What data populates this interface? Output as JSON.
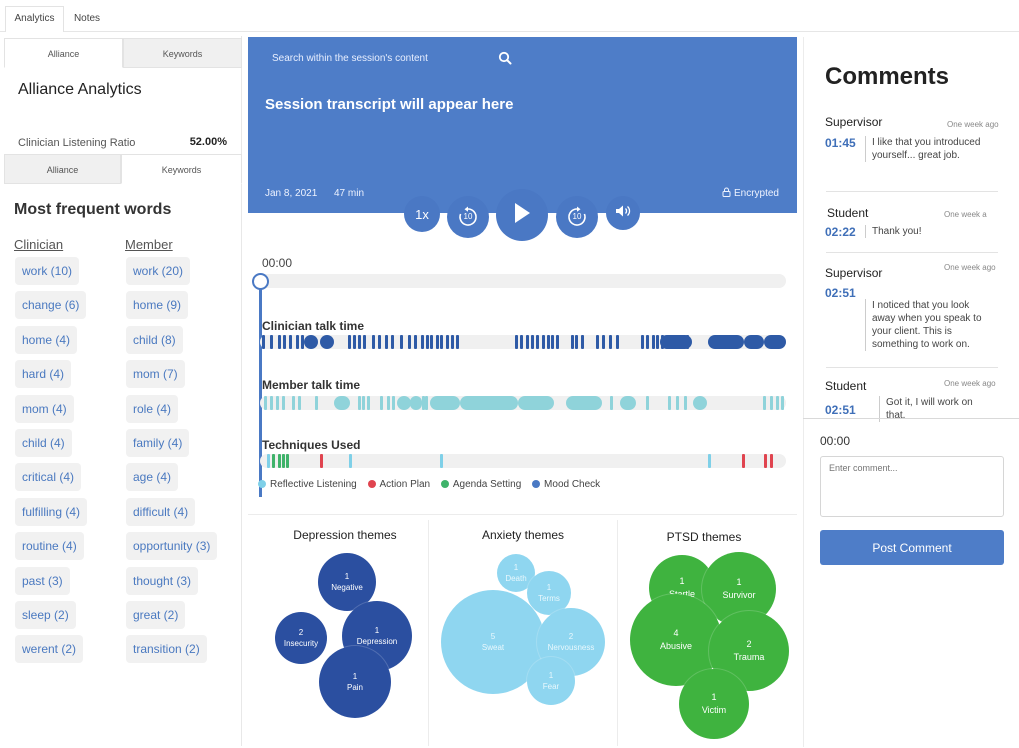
{
  "top_tabs": [
    "Analytics",
    "Notes"
  ],
  "left": {
    "subtabs_top": [
      "Alliance",
      "Keywords"
    ],
    "alliance_title": "Alliance Analytics",
    "ratio_label": "Clinician Listening Ratio",
    "ratio_value": "52.00%",
    "subtabs_bottom": [
      "Alliance",
      "Keywords"
    ],
    "words_title": "Most frequent words",
    "clinician_header": "Clinician",
    "member_header": "Member",
    "clinician_words": [
      "work (10)",
      "change (6)",
      "home (4)",
      "hard (4)",
      "mom (4)",
      "child (4)",
      "critical (4)",
      "fulfilling (4)",
      "routine (4)",
      "past (3)",
      "sleep (2)",
      "werent (2)"
    ],
    "member_words": [
      "work (20)",
      "home (9)",
      "child (8)",
      "mom (7)",
      "role (4)",
      "family (4)",
      "age (4)",
      "difficult (4)",
      "opportunity (3)",
      "thought (3)",
      "great (2)",
      "transition (2)"
    ]
  },
  "player": {
    "search_placeholder": "Search within the session's content",
    "transcript_title": "Session transcript will appear here",
    "date": "Jan 8, 2021",
    "duration": "47 min",
    "encrypted": "Encrypted",
    "speed": "1x",
    "skip_back": "10",
    "skip_fwd": "10",
    "current_time": "00:00"
  },
  "timelines": {
    "clinician_label": "Clinician talk time",
    "member_label": "Member talk time",
    "techniques_label": "Techniques Used",
    "legend": [
      {
        "label": "Reflective Listening",
        "color": "#7fd0e8"
      },
      {
        "label": "Action Plan",
        "color": "#e0444f"
      },
      {
        "label": "Agenda Setting",
        "color": "#3fb36a"
      },
      {
        "label": "Mood Check",
        "color": "#4a79c4"
      }
    ]
  },
  "themes": [
    {
      "title": "Depression themes",
      "color": "#2b4fa0",
      "bubbles": [
        {
          "n": "1",
          "label": "Negative"
        },
        {
          "n": "2",
          "label": "Insecurity"
        },
        {
          "n": "1",
          "label": "Depression"
        },
        {
          "n": "1",
          "label": "Pain"
        }
      ]
    },
    {
      "title": "Anxiety themes",
      "color": "#8fd6f0",
      "bubbles": [
        {
          "n": "1",
          "label": "Death"
        },
        {
          "n": "1",
          "label": "Terms"
        },
        {
          "n": "5",
          "label": "Sweat"
        },
        {
          "n": "2",
          "label": "Nervousness"
        },
        {
          "n": "1",
          "label": "Fear"
        }
      ]
    },
    {
      "title": "PTSD themes",
      "color": "#3fb33f",
      "bubbles": [
        {
          "n": "1",
          "label": "Startle"
        },
        {
          "n": "1",
          "label": "Survivor"
        },
        {
          "n": "4",
          "label": "Abusive"
        },
        {
          "n": "2",
          "label": "Trauma"
        },
        {
          "n": "1",
          "label": "Victim"
        }
      ]
    }
  ],
  "comments": {
    "title": "Comments",
    "items": [
      {
        "author": "Supervisor",
        "ago": "One week ago",
        "time": "01:45",
        "text": "I like that you introduced yourself... great job."
      },
      {
        "author": "Student",
        "ago": "One week a",
        "time": "02:22",
        "text": "Thank you!"
      },
      {
        "author": "Supervisor",
        "ago": "One week ago",
        "time": "02:51",
        "text": "I noticed that you look away when you speak to your client. This is something to work on."
      },
      {
        "author": "Student",
        "ago": "One week ago",
        "time": "02:51",
        "text": "Got it, I will work on that."
      }
    ],
    "composer_time": "00:00",
    "composer_placeholder": "Enter comment...",
    "post_label": "Post Comment"
  }
}
